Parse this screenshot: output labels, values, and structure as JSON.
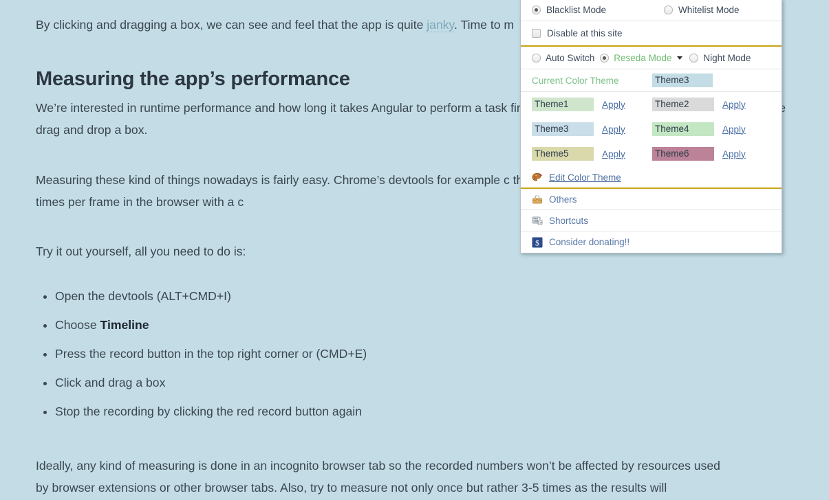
{
  "article": {
    "intro_before": "By clicking and dragging a box, we can see and feel that the app is quite ",
    "intro_link": "janky",
    "intro_after": ". Time to m",
    "heading": "Measuring the app’s performance",
    "p_interested": "We’re interested in runtime performance and how long it takes Angular to perform a task fired, as this is the work Angular has to do when we drag and drop a box.",
    "p_nowadays": "Measuring these kind of things nowadays is fairly easy. Chrome’s devtools for example c that lets us profile JavaScript execution and paint times per frame in the browser with a c",
    "p_tryit": "Try it out yourself, all you need to do is:",
    "steps": [
      {
        "text": "Open the devtools (ALT+CMD+I)",
        "bold": ""
      },
      {
        "text": "Choose ",
        "bold": "Timeline"
      },
      {
        "text": "Press the record button in the top right corner or (CMD+E)",
        "bold": ""
      },
      {
        "text": "Click and drag a box",
        "bold": ""
      },
      {
        "text": "Stop the recording by clicking the red record button again",
        "bold": ""
      }
    ],
    "p_ideally": "Ideally, any kind of measuring is done in an incognito browser tab so the recorded numbers won’t be affected by resources used by browser extensions or other browser tabs. Also, try to measure not only once but rather 3-5 times as the results will"
  },
  "popup": {
    "mode_row": {
      "blacklist_label": "Blacklist Mode",
      "blacklist_selected": true,
      "whitelist_label": "Whitelist Mode",
      "whitelist_selected": false
    },
    "disable_row": {
      "label": "Disable at this site",
      "checked": false
    },
    "switch_row": {
      "auto_label": "Auto Switch",
      "auto_selected": false,
      "reseda_label": "Reseda Mode",
      "reseda_selected": true,
      "reseda_color": "#6fbb6f",
      "night_label": "Night Mode",
      "night_selected": false,
      "caret_icon": "chevron-down-icon"
    },
    "current_theme": {
      "label": "Current Color Theme",
      "label_color": "#7cc08a",
      "value": "Theme3",
      "value_bg": "#c3dce5"
    },
    "apply_label": "Apply",
    "themes": [
      {
        "name": "Theme1",
        "color": "#cfe6cc"
      },
      {
        "name": "Theme2",
        "color": "#dadada"
      },
      {
        "name": "Theme3",
        "color": "#c9dee8"
      },
      {
        "name": "Theme4",
        "color": "#c3e6c3"
      },
      {
        "name": "Theme5",
        "color": "#d9d9ac"
      },
      {
        "name": "Theme6",
        "color": "#bb8298"
      }
    ],
    "menu": [
      {
        "label": "Edit Color Theme",
        "icon": "palette-icon",
        "underline": true
      },
      {
        "label": "Others",
        "icon": "toolbox-icon",
        "underline": false
      },
      {
        "label": "Shortcuts",
        "icon": "keyboard-icon",
        "underline": false
      },
      {
        "label": "Consider donating!!",
        "icon": "dollar-badge-icon",
        "underline": false
      }
    ]
  },
  "colors": {
    "page_bg": "#c3dce5",
    "panel_bg": "#ffffff",
    "gold_rule": "#c8a415",
    "link": "#4a6fa5"
  }
}
